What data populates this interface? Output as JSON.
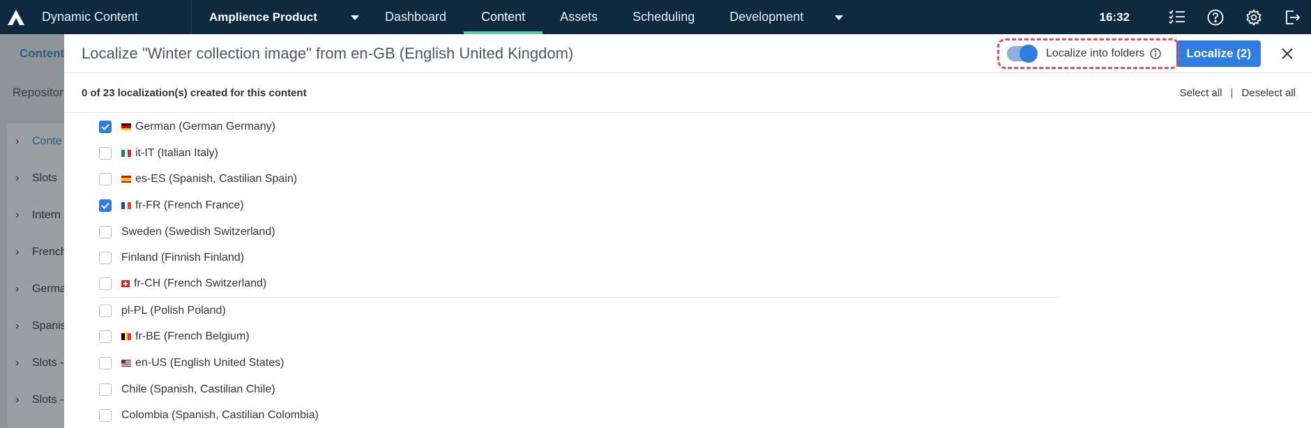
{
  "topbar": {
    "app_title": "Dynamic Content",
    "hub": "Amplience Product",
    "tabs": [
      {
        "label": "Dashboard",
        "active": false
      },
      {
        "label": "Content",
        "active": true
      },
      {
        "label": "Assets",
        "active": false
      },
      {
        "label": "Scheduling",
        "active": false
      },
      {
        "label": "Development",
        "active": false
      }
    ],
    "time": "16:32"
  },
  "background_page": {
    "content_label": "Content",
    "repository_label": "Repositor",
    "items": [
      "Conte",
      "Slots",
      "Intern",
      "French",
      "Germa",
      "Spanis",
      "Slots -",
      "Slots -"
    ]
  },
  "modal": {
    "title": "Localize \"Winter collection image\" from en-GB (English United Kingdom)",
    "toggle_label": "Localize into folders",
    "toggle_on": true,
    "localize_button": "Localize (2)",
    "count_text": "0 of 23 localization(s) created for this content",
    "select_all": "Select all",
    "separator": "|",
    "deselect_all": "Deselect all",
    "locales": [
      {
        "label": "German (German Germany)",
        "checked": true,
        "flag": "de"
      },
      {
        "label": "it-IT (Italian Italy)",
        "checked": false,
        "flag": "it"
      },
      {
        "label": "es-ES (Spanish, Castilian Spain)",
        "checked": false,
        "flag": "es"
      },
      {
        "label": "fr-FR (French France)",
        "checked": true,
        "flag": "fr"
      },
      {
        "label": "Sweden (Swedish Switzerland)",
        "checked": false,
        "flag": ""
      },
      {
        "label": "Finland (Finnish Finland)",
        "checked": false,
        "flag": ""
      },
      {
        "label": "fr-CH (French Switzerland)",
        "checked": false,
        "flag": "ch"
      },
      {
        "label": "pl-PL (Polish Poland)",
        "checked": false,
        "flag": ""
      },
      {
        "label": "fr-BE (French Belgium)",
        "checked": false,
        "flag": "be"
      },
      {
        "label": "en-US (English United States)",
        "checked": false,
        "flag": "us"
      },
      {
        "label": "Chile (Spanish, Castilian Chile)",
        "checked": false,
        "flag": ""
      },
      {
        "label": "Colombia (Spanish, Castilian Colombia)",
        "checked": false,
        "flag": ""
      }
    ]
  },
  "colors": {
    "topbar_bg": "#0f2a3e",
    "accent": "#2e7de0",
    "active_tab_underline": "#50d3a7",
    "highlight": "#e04d64"
  }
}
